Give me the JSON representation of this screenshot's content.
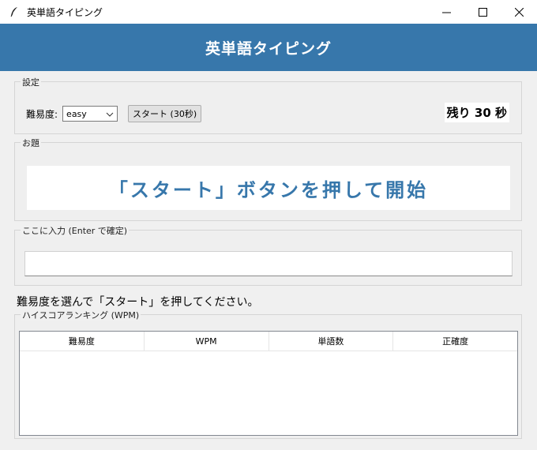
{
  "window": {
    "title": "英単語タイピング",
    "icon": "feather-icon",
    "controls": [
      "minimize-icon",
      "maximize-icon",
      "close-icon"
    ]
  },
  "header": {
    "title": "英単語タイピング",
    "color": "#3777ab"
  },
  "settings": {
    "group_label": "設定",
    "difficulty_label": "難易度:",
    "difficulty_value": "easy",
    "start_button_label": "スタート (30秒)",
    "timer_text": "残り 30 秒"
  },
  "prompt": {
    "group_label": "お題",
    "text": "「スタート」ボタンを押して開始",
    "color": "#3777ab"
  },
  "input": {
    "group_label": "ここに入力 (Enter で確定)",
    "value": ""
  },
  "status_message": "難易度を選んで「スタート」を押してください。",
  "ranking": {
    "group_label": "ハイスコアランキング (WPM)",
    "columns": [
      "難易度",
      "WPM",
      "単語数",
      "正確度"
    ],
    "rows": []
  }
}
